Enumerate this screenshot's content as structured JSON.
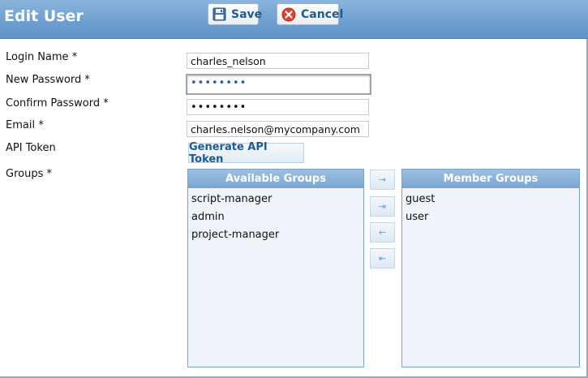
{
  "header": {
    "title": "Edit User",
    "save_label": "Save",
    "cancel_label": "Cancel"
  },
  "form": {
    "login_name": {
      "label": "Login Name *",
      "value": "charles_nelson"
    },
    "new_password": {
      "label": "New Password *",
      "value": "••••••••"
    },
    "confirm_password": {
      "label": "Confirm Password *",
      "value": "••••••••"
    },
    "email": {
      "label": "Email *",
      "value": "charles.nelson@mycompany.com"
    },
    "api_token": {
      "label": "API Token",
      "button_label": "Generate API Token"
    },
    "groups": {
      "label": "Groups *"
    }
  },
  "groups": {
    "available": {
      "title": "Available Groups",
      "items": [
        "script-manager",
        "admin",
        "project-manager"
      ]
    },
    "member": {
      "title": "Member Groups",
      "items": [
        "guest",
        "user"
      ]
    },
    "transfer_buttons": {
      "add_icon": "arrow-right-icon",
      "add_all_icon": "arrow-right-all-icon",
      "remove_icon": "arrow-left-icon",
      "remove_all_icon": "arrow-left-all-icon"
    }
  },
  "colors": {
    "header_bg": "#6d9ed0",
    "button_text": "#1f5a91",
    "listbox_bg": "#eef4fa",
    "listbox_head": "#7aa6d3"
  }
}
